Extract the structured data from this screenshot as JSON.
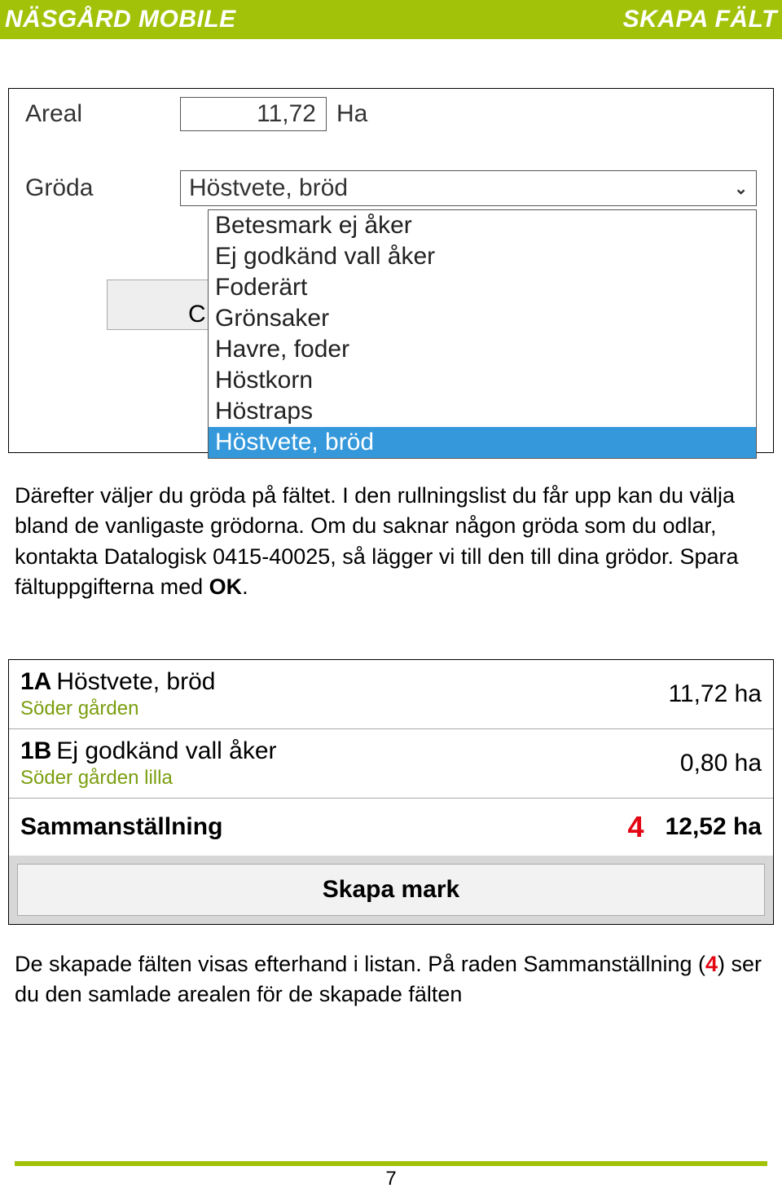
{
  "header": {
    "left": "NÄSGÅRD MOBILE",
    "right": "SKAPA FÄLT"
  },
  "form1": {
    "areal_label": "Areal",
    "areal_value": "11,72",
    "areal_unit": "Ha",
    "groda_label": "Gröda",
    "groda_selected": "Höstvete, bröd",
    "behind_letter": "C",
    "dropdown_items": [
      "Betesmark ej åker",
      "Ej godkänd vall åker",
      "Foderärt",
      "Grönsaker",
      "Havre, foder",
      "Höstkorn",
      "Höstraps",
      "Höstvete, bröd"
    ],
    "dropdown_selected_index": 7
  },
  "paragraph1": {
    "t1": "Därefter väljer du gröda på fältet. I den rullningslist du får upp kan du välja bland de vanligaste grödorna. Om du saknar någon gröda som du odlar, kontakta Datalogisk 0415-40025, så lägger vi till den till dina grödor. Spara fältuppgifterna med ",
    "t2": "OK",
    "t3": "."
  },
  "list2": {
    "rows": [
      {
        "code": "1A",
        "crop": "Höstvete, bröd",
        "sub": "Söder gården",
        "area": "11,72 ha"
      },
      {
        "code": "1B",
        "crop": "Ej godkänd vall åker",
        "sub": "Söder gården lilla",
        "area": "0,80 ha"
      }
    ],
    "summary_label": "Sammanställning",
    "summary_num": "4",
    "summary_area": "12,52 ha",
    "skapa_btn": "Skapa mark"
  },
  "paragraph2": {
    "t1": "De skapade fälten visas efterhand i listan. På raden Sammanställning (",
    "num": "4",
    "t2": ") ser du den samlade arealen för de skapade fälten"
  },
  "page_number": "7"
}
